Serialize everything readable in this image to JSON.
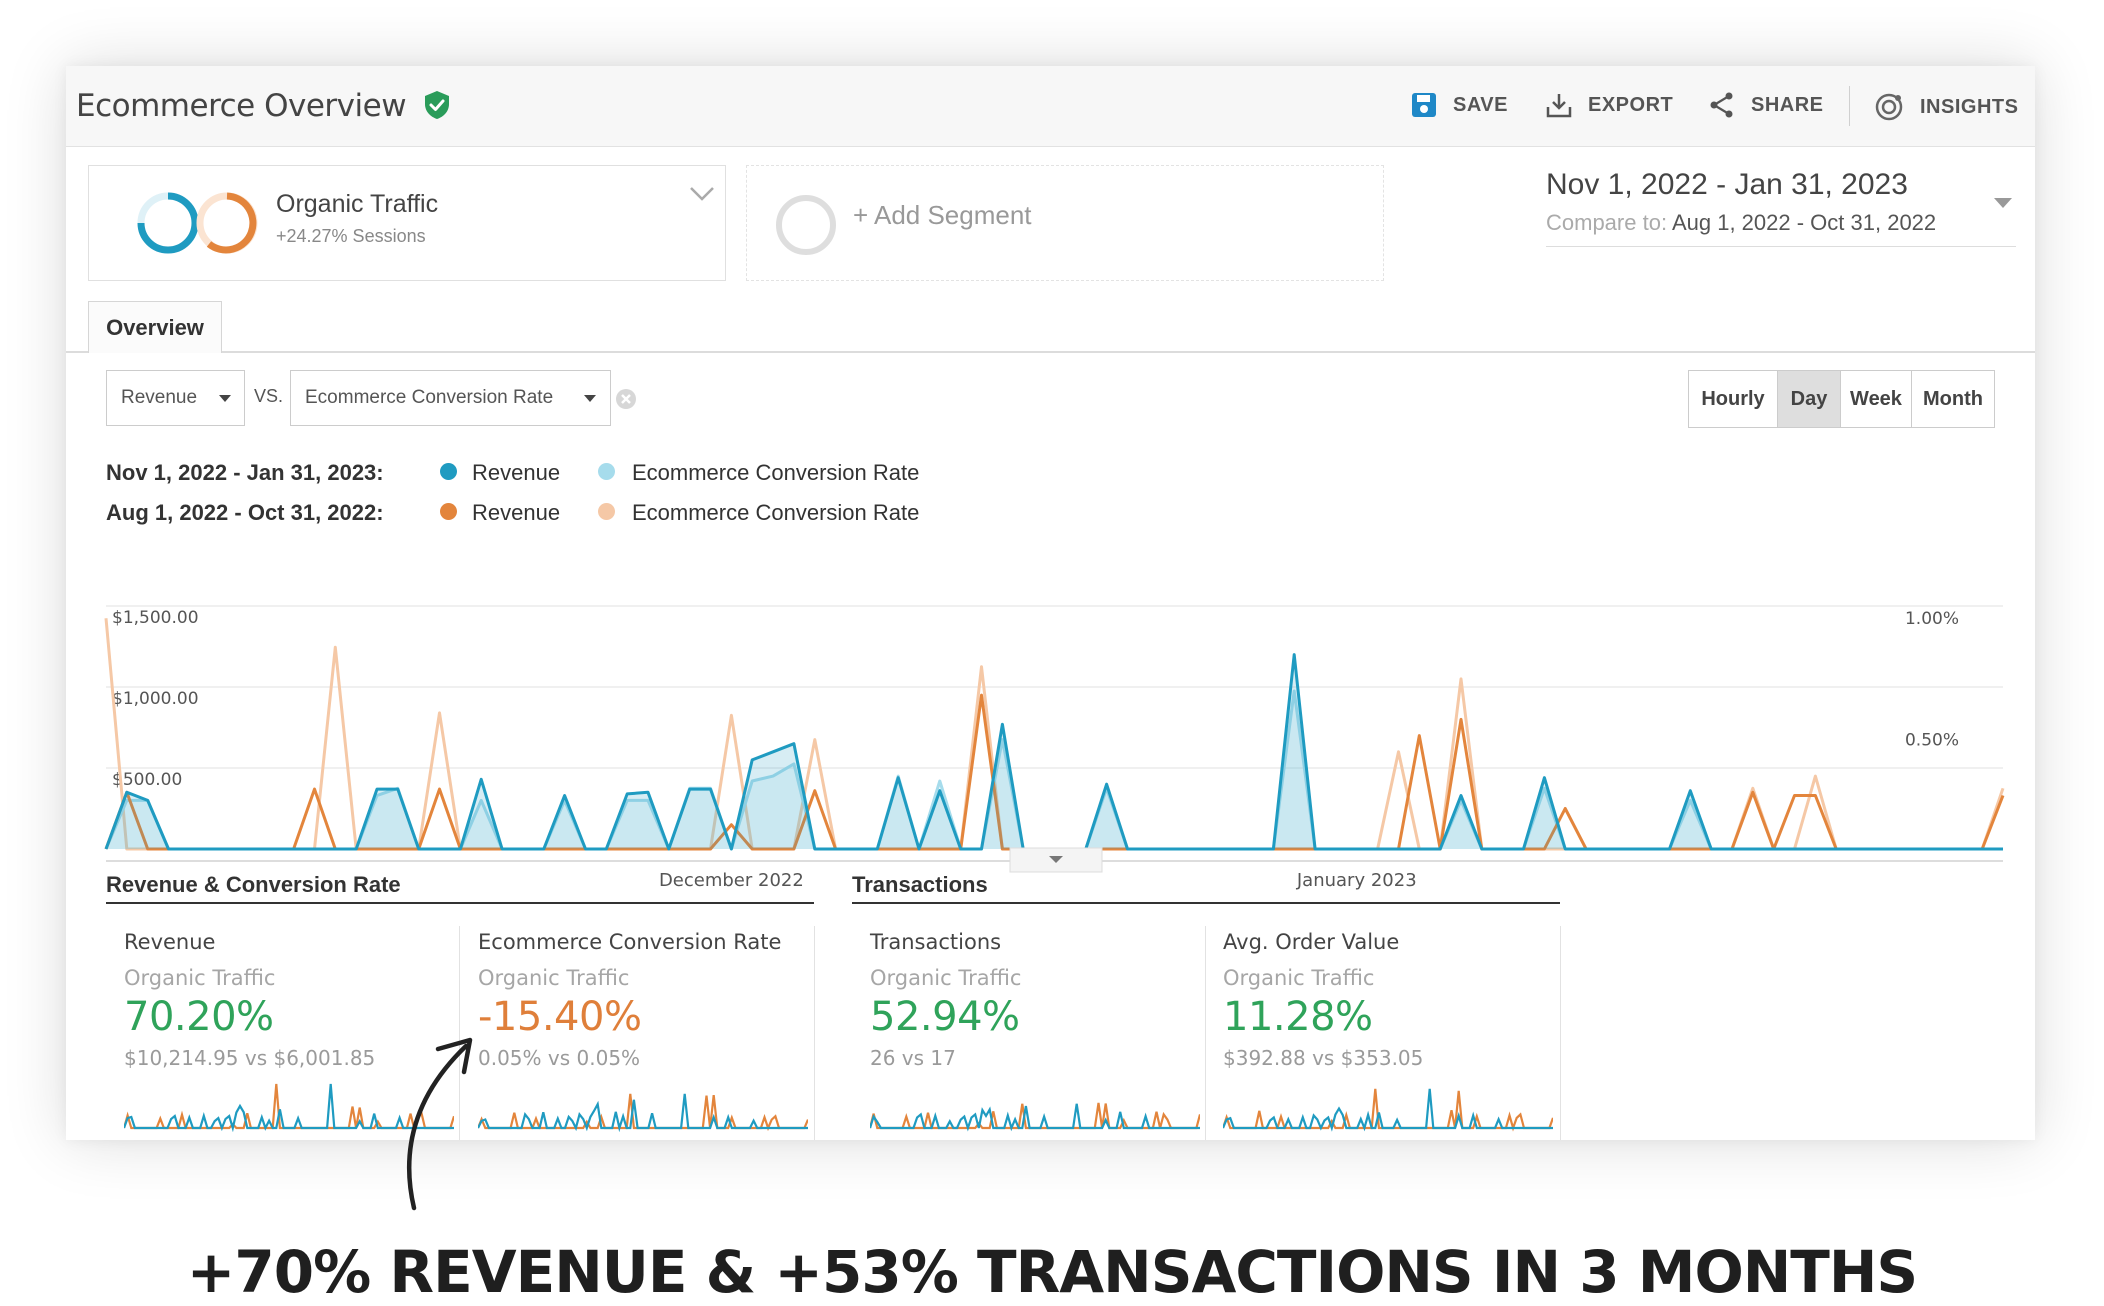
{
  "header": {
    "title": "Ecommerce Overview",
    "save_label": "SAVE",
    "export_label": "EXPORT",
    "share_label": "SHARE",
    "insights_label": "INSIGHTS"
  },
  "segments": {
    "primary": {
      "name": "Organic Traffic",
      "sub": "+24.27% Sessions"
    },
    "add_label": "+ Add Segment"
  },
  "date_range": {
    "range": "Nov 1, 2022 - Jan 31, 2023",
    "compare_prefix": "Compare to:",
    "compare_range": "Aug 1, 2022 - Oct 31, 2022"
  },
  "tabs": [
    {
      "label": "Overview"
    }
  ],
  "controls": {
    "metric1": "Revenue",
    "vs_label": "VS.",
    "metric2": "Ecommerce Conversion Rate",
    "granularity": [
      "Hourly",
      "Day",
      "Week",
      "Month"
    ],
    "granularity_selected": "Day"
  },
  "legend": {
    "current_label": "Nov 1, 2022 - Jan 31, 2023:",
    "previous_label": "Aug 1, 2022 - Oct 31, 2022:",
    "series_a": "Revenue",
    "series_b": "Ecommerce Conversion Rate"
  },
  "colors": {
    "current_revenue": "#1f9bc1",
    "current_rate": "#a6dcec",
    "previous_revenue": "#e3853c",
    "previous_rate": "#f5c8a6",
    "positive": "#2fa35a",
    "negative": "#df7f3a",
    "verified": "#2a9c5a"
  },
  "chart_data": {
    "type": "line",
    "x_ticks": [
      "December 2022",
      "January 2023"
    ],
    "y_ticks_left": [
      "$1,500.00",
      "$1,000.00",
      "$500.00"
    ],
    "y_ticks_right": [
      "1.00%",
      "0.50%"
    ],
    "ylim": [
      0,
      1500
    ],
    "ylim_right": [
      0,
      1.0
    ],
    "days": 92,
    "series": [
      {
        "name": "Revenue",
        "period": "Nov 1, 2022 - Jan 31, 2023",
        "axis": "left",
        "fill": true,
        "peaks": [
          [
            1,
            350
          ],
          [
            2,
            300
          ],
          [
            13,
            370
          ],
          [
            14,
            370
          ],
          [
            18,
            430
          ],
          [
            22,
            330
          ],
          [
            25,
            340
          ],
          [
            26,
            350
          ],
          [
            28,
            370
          ],
          [
            29,
            370
          ],
          [
            31,
            550
          ],
          [
            32,
            600
          ],
          [
            33,
            650
          ],
          [
            38,
            440
          ],
          [
            40,
            360
          ],
          [
            43,
            770
          ],
          [
            48,
            400
          ],
          [
            57,
            1200
          ],
          [
            65,
            330
          ],
          [
            69,
            440
          ],
          [
            76,
            360
          ]
        ]
      },
      {
        "name": "Ecommerce Conversion Rate",
        "period": "Nov 1, 2022 - Jan 31, 2023",
        "axis": "right",
        "fill": true,
        "peaks": [
          [
            1,
            0.2
          ],
          [
            2,
            0.2
          ],
          [
            13,
            0.22
          ],
          [
            14,
            0.25
          ],
          [
            18,
            0.2
          ],
          [
            22,
            0.2
          ],
          [
            25,
            0.2
          ],
          [
            26,
            0.2
          ],
          [
            28,
            0.25
          ],
          [
            29,
            0.25
          ],
          [
            31,
            0.28
          ],
          [
            32,
            0.3
          ],
          [
            33,
            0.35
          ],
          [
            38,
            0.3
          ],
          [
            40,
            0.28
          ],
          [
            43,
            0.45
          ],
          [
            48,
            0.25
          ],
          [
            57,
            0.65
          ],
          [
            65,
            0.2
          ],
          [
            69,
            0.25
          ],
          [
            76,
            0.2
          ]
        ]
      },
      {
        "name": "Revenue",
        "period": "Aug 1, 2022 - Oct 31, 2022",
        "axis": "left",
        "fill": false,
        "peaks": [
          [
            1,
            350
          ],
          [
            10,
            370
          ],
          [
            16,
            370
          ],
          [
            30,
            150
          ],
          [
            34,
            360
          ],
          [
            42,
            950
          ],
          [
            63,
            700
          ],
          [
            65,
            800
          ],
          [
            70,
            250
          ],
          [
            79,
            350
          ],
          [
            81,
            330
          ],
          [
            82,
            330
          ],
          [
            91,
            330
          ]
        ]
      },
      {
        "name": "Ecommerce Conversion Rate",
        "period": "Aug 1, 2022 - Oct 31, 2022",
        "axis": "right",
        "fill": false,
        "peaks": [
          [
            0,
            0.95
          ],
          [
            11,
            0.83
          ],
          [
            16,
            0.56
          ],
          [
            30,
            0.55
          ],
          [
            34,
            0.45
          ],
          [
            42,
            0.75
          ],
          [
            62,
            0.4
          ],
          [
            65,
            0.7
          ],
          [
            79,
            0.25
          ],
          [
            82,
            0.3
          ],
          [
            91,
            0.25
          ]
        ]
      }
    ]
  },
  "sections": [
    {
      "title": "Revenue & Conversion Rate",
      "metrics": [
        {
          "name": "Revenue",
          "segment": "Organic Traffic",
          "value": "70.20%",
          "compare": "$10,214.95 vs $6,001.85",
          "trend": "positive"
        },
        {
          "name": "Ecommerce Conversion Rate",
          "segment": "Organic Traffic",
          "value": "-15.40%",
          "compare": "0.05% vs 0.05%",
          "trend": "negative"
        }
      ]
    },
    {
      "title": "Transactions",
      "metrics": [
        {
          "name": "Transactions",
          "segment": "Organic Traffic",
          "value": "52.94%",
          "compare": "26 vs 17",
          "trend": "positive"
        },
        {
          "name": "Avg. Order Value",
          "segment": "Organic Traffic",
          "value": "11.28%",
          "compare": "$392.88 vs $353.05",
          "trend": "positive"
        }
      ]
    }
  ],
  "caption": "+70% REVENUE & +53% TRANSACTIONS IN 3 MONTHS"
}
